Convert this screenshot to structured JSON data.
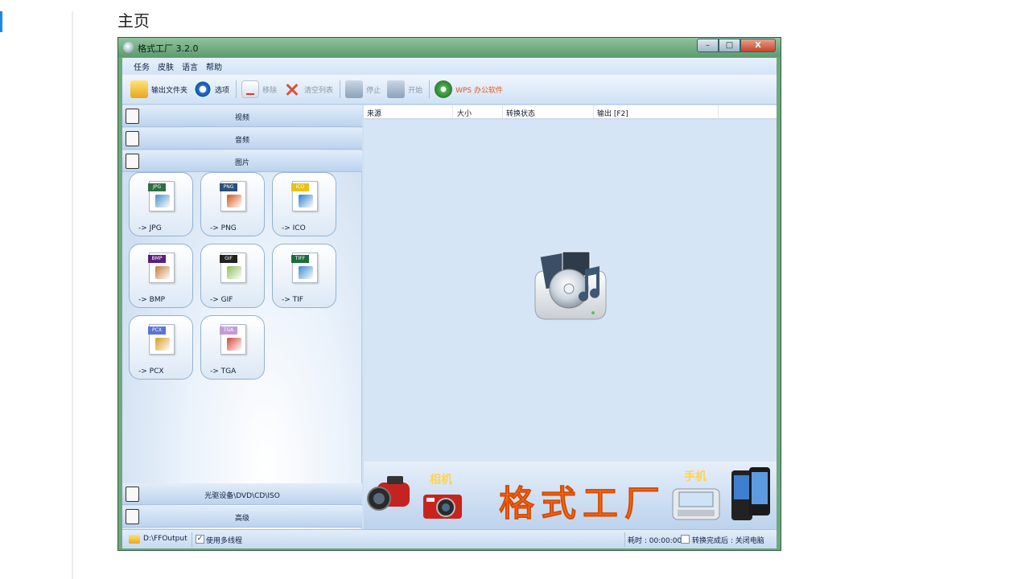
{
  "page": {
    "title": "主页"
  },
  "window": {
    "title": "格式工厂 3.2.0",
    "minimize": "–",
    "maximize": "□",
    "close": "X"
  },
  "menu": [
    "任务",
    "皮肤",
    "语言",
    "帮助"
  ],
  "toolbar": {
    "output_folder": "输出文件夹",
    "options": "选项",
    "remove": "移除",
    "clear_list": "清空列表",
    "stop": "停止",
    "start": "开始",
    "wps": "WPS 办公软件"
  },
  "categories": {
    "video": "视频",
    "audio": "音频",
    "image": "图片",
    "optical": "光驱设备\\DVD\\CD\\ISO",
    "advanced": "高级"
  },
  "tiles": [
    {
      "tag": "JPG",
      "label": "-> JPG",
      "tag_color": "#2e6e43",
      "img_color": "#4a8fc7"
    },
    {
      "tag": "PNG",
      "label": "-> PNG",
      "tag_color": "#2a4f7a",
      "img_color": "#d2551e"
    },
    {
      "tag": "ICO",
      "label": "-> ICO",
      "tag_color": "#e8c21a",
      "img_color": "#2f7ecb"
    },
    {
      "tag": "BMP",
      "label": "-> BMP",
      "tag_color": "#5a1f7a",
      "img_color": "#c77b3a"
    },
    {
      "tag": "GIF",
      "label": "-> GIF",
      "tag_color": "#222222",
      "img_color": "#8bbf5a"
    },
    {
      "tag": "TIFF",
      "label": "-> TIF",
      "tag_color": "#1d6b3e",
      "img_color": "#3b8ad0"
    },
    {
      "tag": "PCX",
      "label": "-> PCX",
      "tag_color": "#5a74d6",
      "img_color": "#d49a1f"
    },
    {
      "tag": "TGA",
      "label": "-> TGA",
      "tag_color": "#c39bd8",
      "img_color": "#d2453a"
    }
  ],
  "list_columns": [
    "来源",
    "大小",
    "转换状态",
    "输出 [F2]"
  ],
  "banner": {
    "title": "格式工厂",
    "camera_tag": "相机",
    "phone_tag": "手机"
  },
  "status": {
    "output_path": "D:\\FFOutput",
    "multithread_check": "✓",
    "multithread": "使用多线程",
    "elapsed": "耗时 : 00:00:00",
    "after": "转换完成后 : 关闭电脑"
  },
  "colors": {
    "accent": "#1e88e5",
    "title_bar": "#6fa77f",
    "banner_text": "#f36a1a"
  }
}
